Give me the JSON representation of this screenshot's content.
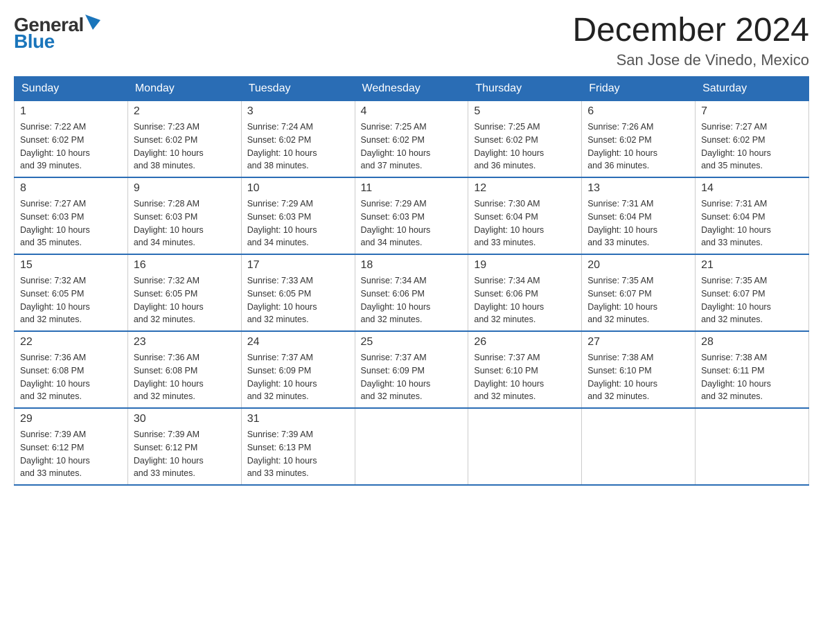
{
  "logo": {
    "general": "General",
    "blue": "Blue"
  },
  "title": {
    "month_year": "December 2024",
    "location": "San Jose de Vinedo, Mexico"
  },
  "headers": [
    "Sunday",
    "Monday",
    "Tuesday",
    "Wednesday",
    "Thursday",
    "Friday",
    "Saturday"
  ],
  "weeks": [
    [
      {
        "day": "1",
        "sunrise": "7:22 AM",
        "sunset": "6:02 PM",
        "daylight": "10 hours and 39 minutes."
      },
      {
        "day": "2",
        "sunrise": "7:23 AM",
        "sunset": "6:02 PM",
        "daylight": "10 hours and 38 minutes."
      },
      {
        "day": "3",
        "sunrise": "7:24 AM",
        "sunset": "6:02 PM",
        "daylight": "10 hours and 38 minutes."
      },
      {
        "day": "4",
        "sunrise": "7:25 AM",
        "sunset": "6:02 PM",
        "daylight": "10 hours and 37 minutes."
      },
      {
        "day": "5",
        "sunrise": "7:25 AM",
        "sunset": "6:02 PM",
        "daylight": "10 hours and 36 minutes."
      },
      {
        "day": "6",
        "sunrise": "7:26 AM",
        "sunset": "6:02 PM",
        "daylight": "10 hours and 36 minutes."
      },
      {
        "day": "7",
        "sunrise": "7:27 AM",
        "sunset": "6:02 PM",
        "daylight": "10 hours and 35 minutes."
      }
    ],
    [
      {
        "day": "8",
        "sunrise": "7:27 AM",
        "sunset": "6:03 PM",
        "daylight": "10 hours and 35 minutes."
      },
      {
        "day": "9",
        "sunrise": "7:28 AM",
        "sunset": "6:03 PM",
        "daylight": "10 hours and 34 minutes."
      },
      {
        "day": "10",
        "sunrise": "7:29 AM",
        "sunset": "6:03 PM",
        "daylight": "10 hours and 34 minutes."
      },
      {
        "day": "11",
        "sunrise": "7:29 AM",
        "sunset": "6:03 PM",
        "daylight": "10 hours and 34 minutes."
      },
      {
        "day": "12",
        "sunrise": "7:30 AM",
        "sunset": "6:04 PM",
        "daylight": "10 hours and 33 minutes."
      },
      {
        "day": "13",
        "sunrise": "7:31 AM",
        "sunset": "6:04 PM",
        "daylight": "10 hours and 33 minutes."
      },
      {
        "day": "14",
        "sunrise": "7:31 AM",
        "sunset": "6:04 PM",
        "daylight": "10 hours and 33 minutes."
      }
    ],
    [
      {
        "day": "15",
        "sunrise": "7:32 AM",
        "sunset": "6:05 PM",
        "daylight": "10 hours and 32 minutes."
      },
      {
        "day": "16",
        "sunrise": "7:32 AM",
        "sunset": "6:05 PM",
        "daylight": "10 hours and 32 minutes."
      },
      {
        "day": "17",
        "sunrise": "7:33 AM",
        "sunset": "6:05 PM",
        "daylight": "10 hours and 32 minutes."
      },
      {
        "day": "18",
        "sunrise": "7:34 AM",
        "sunset": "6:06 PM",
        "daylight": "10 hours and 32 minutes."
      },
      {
        "day": "19",
        "sunrise": "7:34 AM",
        "sunset": "6:06 PM",
        "daylight": "10 hours and 32 minutes."
      },
      {
        "day": "20",
        "sunrise": "7:35 AM",
        "sunset": "6:07 PM",
        "daylight": "10 hours and 32 minutes."
      },
      {
        "day": "21",
        "sunrise": "7:35 AM",
        "sunset": "6:07 PM",
        "daylight": "10 hours and 32 minutes."
      }
    ],
    [
      {
        "day": "22",
        "sunrise": "7:36 AM",
        "sunset": "6:08 PM",
        "daylight": "10 hours and 32 minutes."
      },
      {
        "day": "23",
        "sunrise": "7:36 AM",
        "sunset": "6:08 PM",
        "daylight": "10 hours and 32 minutes."
      },
      {
        "day": "24",
        "sunrise": "7:37 AM",
        "sunset": "6:09 PM",
        "daylight": "10 hours and 32 minutes."
      },
      {
        "day": "25",
        "sunrise": "7:37 AM",
        "sunset": "6:09 PM",
        "daylight": "10 hours and 32 minutes."
      },
      {
        "day": "26",
        "sunrise": "7:37 AM",
        "sunset": "6:10 PM",
        "daylight": "10 hours and 32 minutes."
      },
      {
        "day": "27",
        "sunrise": "7:38 AM",
        "sunset": "6:10 PM",
        "daylight": "10 hours and 32 minutes."
      },
      {
        "day": "28",
        "sunrise": "7:38 AM",
        "sunset": "6:11 PM",
        "daylight": "10 hours and 32 minutes."
      }
    ],
    [
      {
        "day": "29",
        "sunrise": "7:39 AM",
        "sunset": "6:12 PM",
        "daylight": "10 hours and 33 minutes."
      },
      {
        "day": "30",
        "sunrise": "7:39 AM",
        "sunset": "6:12 PM",
        "daylight": "10 hours and 33 minutes."
      },
      {
        "day": "31",
        "sunrise": "7:39 AM",
        "sunset": "6:13 PM",
        "daylight": "10 hours and 33 minutes."
      },
      null,
      null,
      null,
      null
    ]
  ],
  "labels": {
    "sunrise_prefix": "Sunrise: ",
    "sunset_prefix": "Sunset: ",
    "daylight_prefix": "Daylight: "
  }
}
